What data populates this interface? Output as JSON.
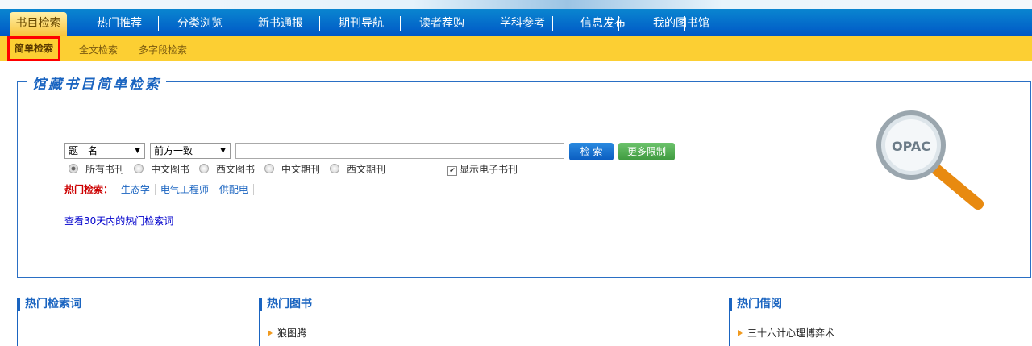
{
  "nav": {
    "items": [
      "书目检索",
      "热门推荐",
      "分类浏览",
      "新书通报",
      "期刊导航",
      "读者荐购",
      "学科参考",
      "信息发布",
      "我的图书馆"
    ]
  },
  "subnav": {
    "items": [
      "简单检索",
      "全文检索",
      "多字段检索"
    ]
  },
  "search": {
    "title": "馆藏书目简单检索",
    "field_select": "题　名",
    "match_select": "前方一致",
    "query_value": "",
    "search_button": "检 索",
    "more_button": "更多限制",
    "radios": [
      "所有书刊",
      "中文图书",
      "西文图书",
      "中文期刊",
      "西文期刊"
    ],
    "ebook_checkbox": "显示电子书刊",
    "hot_label": "热门检索：",
    "hot_terms": [
      "生态学",
      "电气工程师",
      "供配电"
    ],
    "hot30_link": "查看30天内的热门检索词",
    "logo_text": "OPAC"
  },
  "sections": [
    {
      "title": "热门检索词",
      "items": []
    },
    {
      "title": "热门图书",
      "items": [
        "狼图腾"
      ]
    },
    {
      "title": "热门借阅",
      "items": [
        "三十六计心理博弈术"
      ]
    }
  ]
}
